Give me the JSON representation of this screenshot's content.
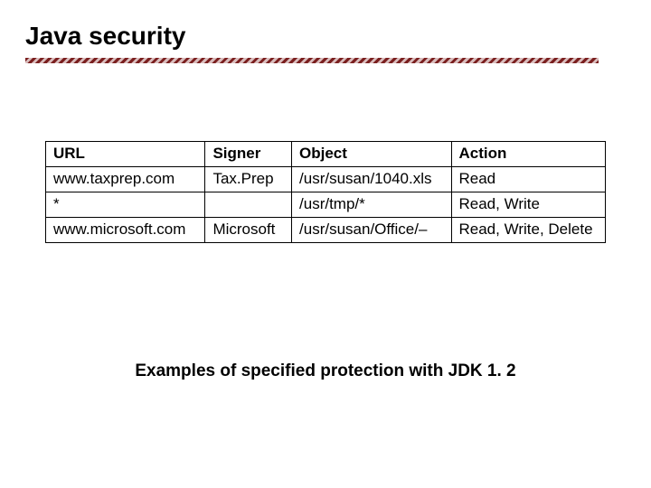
{
  "title": "Java security",
  "table": {
    "headers": {
      "url": "URL",
      "signer": "Signer",
      "object": "Object",
      "action": "Action"
    },
    "rows": [
      {
        "url": "www.taxprep.com",
        "signer": "Tax.Prep",
        "object": "/usr/susan/1040.xls",
        "action": "Read"
      },
      {
        "url": "*",
        "signer": "",
        "object": "/usr/tmp/*",
        "action": "Read, Write"
      },
      {
        "url": "www.microsoft.com",
        "signer": "Microsoft",
        "object": "/usr/susan/Office/–",
        "action": "Read, Write, Delete"
      }
    ]
  },
  "caption": "Examples of specified protection with JDK 1. 2"
}
